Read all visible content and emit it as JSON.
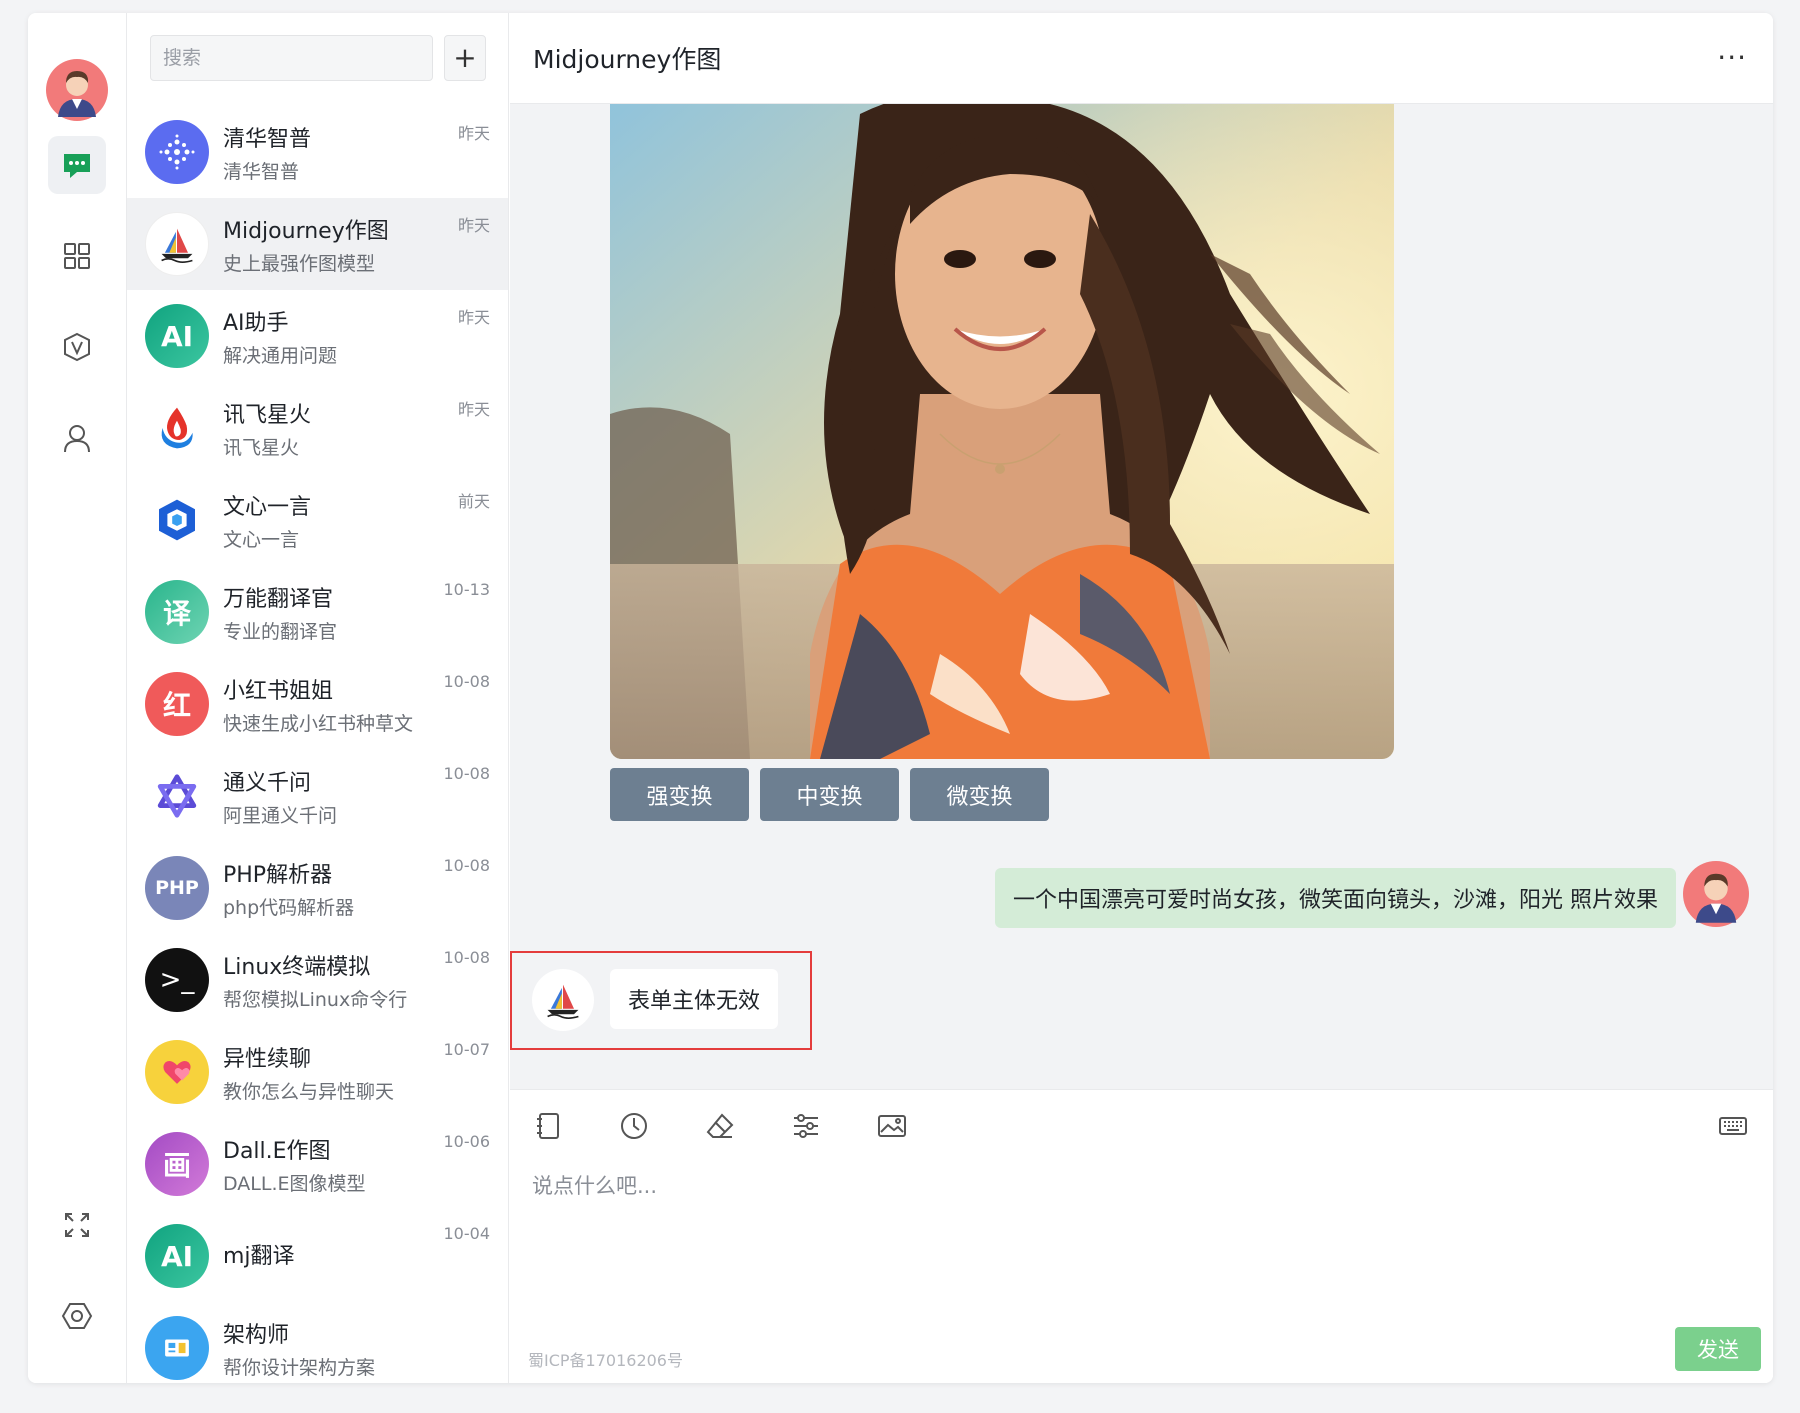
{
  "search": {
    "placeholder": "搜索",
    "add_label": "+"
  },
  "conversations": [
    {
      "name": "清华智普",
      "desc": "清华智普",
      "time": "昨天",
      "icon": "zhipu-logo",
      "color": "#4f6df5"
    },
    {
      "name": "Midjourney作图",
      "desc": "史上最强作图模型",
      "time": "昨天",
      "icon": "midjourney-boat-logo",
      "color": "#ffffff"
    },
    {
      "name": "AI助手",
      "desc": "解决通用问题",
      "time": "昨天",
      "icon": "AI",
      "color": "#1aa37a"
    },
    {
      "name": "讯飞星火",
      "desc": "讯飞星火",
      "time": "昨天",
      "icon": "spark-flame-logo",
      "color": "#ffffff"
    },
    {
      "name": "文心一言",
      "desc": "文心一言",
      "time": "前天",
      "icon": "wenxin-cube-logo",
      "color": "#ffffff"
    },
    {
      "name": "万能翻译官",
      "desc": "专业的翻译官",
      "time": "10-13",
      "icon": "译",
      "color": "#3fbf9a"
    },
    {
      "name": "小红书姐姐",
      "desc": "快速生成小红书种草文",
      "time": "10-08",
      "icon": "红",
      "color": "#f05a5a"
    },
    {
      "name": "通义千问",
      "desc": "阿里通义千问",
      "time": "10-08",
      "icon": "tongyi-star-logo",
      "color": "#ffffff"
    },
    {
      "name": "PHP解析器",
      "desc": "php代码解析器",
      "time": "10-08",
      "icon": "PHP",
      "color": "#7a86b8"
    },
    {
      "name": "Linux终端模拟",
      "desc": "帮您模拟Linux命令行",
      "time": "10-08",
      "icon": ">_",
      "color": "#111111"
    },
    {
      "name": "异性续聊",
      "desc": "教你怎么与异性聊天",
      "time": "10-07",
      "icon": "heart-icon",
      "color": "#f7d23c"
    },
    {
      "name": "Dall.E作图",
      "desc": "DALL.E图像模型",
      "time": "10-06",
      "icon": "画",
      "color": "#b85cc7"
    },
    {
      "name": "mj翻译",
      "desc": "",
      "time": "10-04",
      "icon": "AI",
      "color": "#1aa37a"
    },
    {
      "name": "架构师",
      "desc": "帮你设计架构方案",
      "time": "",
      "icon": "architect-logo",
      "color": "#3ba5f0"
    }
  ],
  "main": {
    "title": "Midjourney作图",
    "more": "···",
    "variation_buttons": [
      "强变换",
      "中变换",
      "微变换"
    ],
    "user_message": "一个中国漂亮可爱时尚女孩，微笑面向镜头，沙滩，阳光 照片效果",
    "bot_message": "表单主体无效"
  },
  "composer": {
    "placeholder": "说点什么吧...",
    "send_label": "发送",
    "icp": "蜀ICP备17016206号",
    "tools": [
      "notebook-icon",
      "history-clock-icon",
      "eraser-icon",
      "settings-sliders-icon",
      "image-icon"
    ]
  }
}
